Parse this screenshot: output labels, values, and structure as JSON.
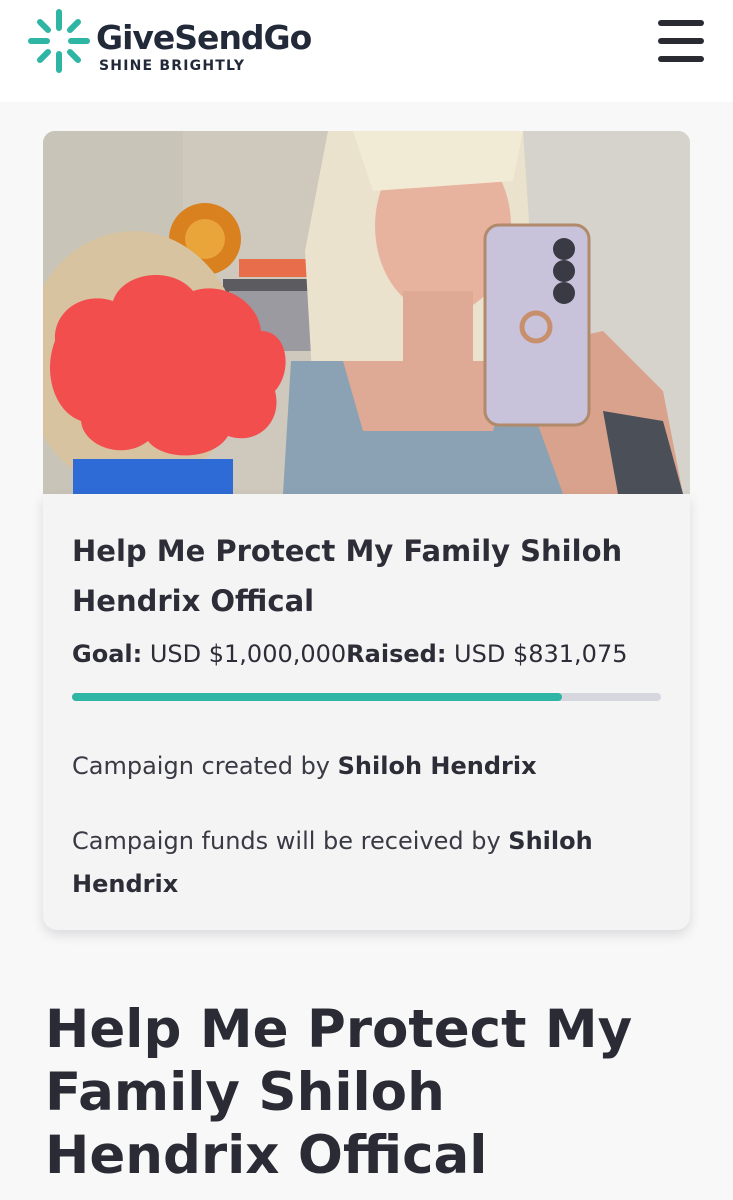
{
  "header": {
    "logo_name": "GiveSendGo",
    "tagline": "SHINE BRIGHTLY",
    "menu_icon": "hamburger-menu-icon",
    "brand_color": "#2eb5a3"
  },
  "campaign": {
    "card_title": "Help Me Protect My Family Shiloh Hendrix Offical",
    "goal_label": "Goal:",
    "goal_value": " USD $1,000,000",
    "raised_label": "Raised:",
    "raised_value": " USD $831,075",
    "progress_fraction": 0.831075,
    "created_prefix": "Campaign created by ",
    "created_name": "Shiloh Hendrix",
    "received_prefix": "Campaign funds will be received by ",
    "received_name": "Shiloh Hendrix"
  },
  "page": {
    "title": "Help Me Protect My Family Shiloh Hendrix Offical"
  },
  "colors": {
    "accent": "#2eb5a3",
    "progress_track": "#d6d6de",
    "text": "#2d2d37",
    "redaction": "#f24e4e"
  }
}
